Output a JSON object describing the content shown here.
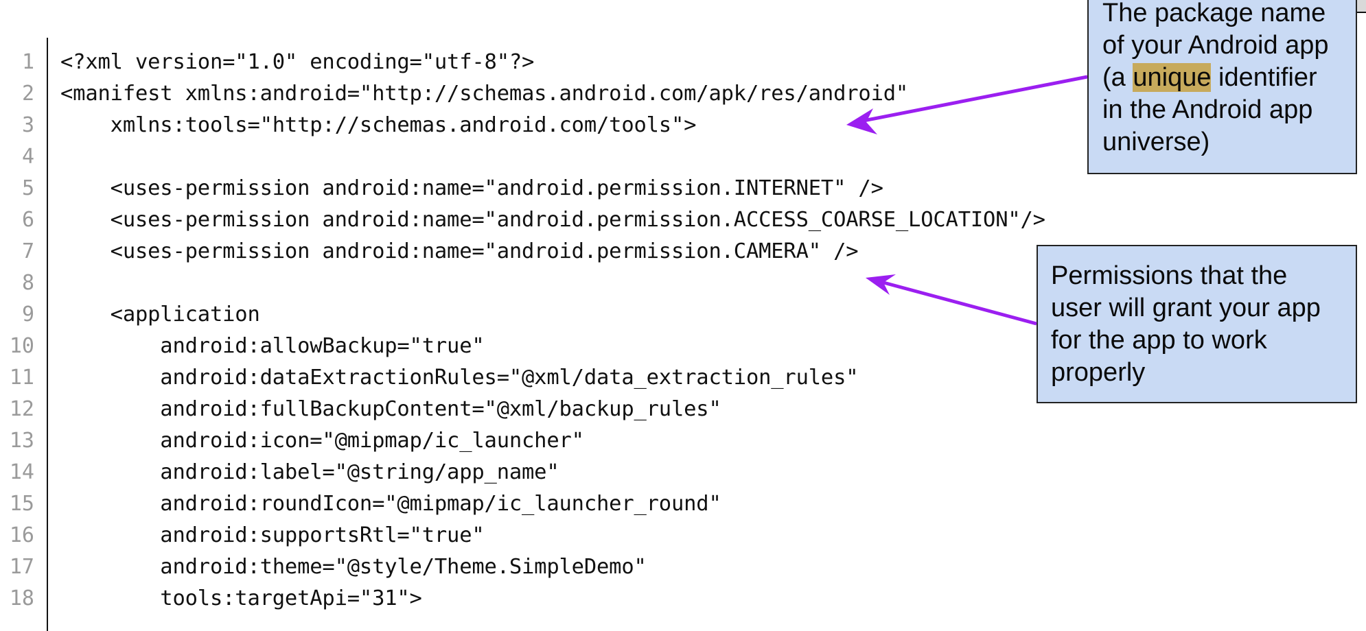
{
  "code": {
    "lines": [
      {
        "n": "1",
        "text": "<?xml version=\"1.0\" encoding=\"utf-8\"?>"
      },
      {
        "n": "2",
        "text": "<manifest xmlns:android=\"http://schemas.android.com/apk/res/android\""
      },
      {
        "n": "3",
        "text": "    xmlns:tools=\"http://schemas.android.com/tools\">"
      },
      {
        "n": "4",
        "text": ""
      },
      {
        "n": "5",
        "text": "    <uses-permission android:name=\"android.permission.INTERNET\" />"
      },
      {
        "n": "6",
        "text": "    <uses-permission android:name=\"android.permission.ACCESS_COARSE_LOCATION\"/>"
      },
      {
        "n": "7",
        "text": "    <uses-permission android:name=\"android.permission.CAMERA\" />"
      },
      {
        "n": "8",
        "text": ""
      },
      {
        "n": "9",
        "text": "    <application"
      },
      {
        "n": "10",
        "text": "        android:allowBackup=\"true\""
      },
      {
        "n": "11",
        "text": "        android:dataExtractionRules=\"@xml/data_extraction_rules\""
      },
      {
        "n": "12",
        "text": "        android:fullBackupContent=\"@xml/backup_rules\""
      },
      {
        "n": "13",
        "text": "        android:icon=\"@mipmap/ic_launcher\""
      },
      {
        "n": "14",
        "text": "        android:label=\"@string/app_name\""
      },
      {
        "n": "15",
        "text": "        android:roundIcon=\"@mipmap/ic_launcher_round\""
      },
      {
        "n": "16",
        "text": "        android:supportsRtl=\"true\""
      },
      {
        "n": "17",
        "text": "        android:theme=\"@style/Theme.SimpleDemo\""
      },
      {
        "n": "18",
        "text": "        tools:targetApi=\"31\">"
      }
    ]
  },
  "callouts": {
    "package_name": {
      "lines": [
        "The package name",
        "of your Android app",
        "(a ",
        "unique",
        " identifier",
        "in the Android app",
        "universe)"
      ]
    },
    "permissions": {
      "lines": [
        "Permissions that the",
        "user will grant your app",
        "for the app to work",
        "properly"
      ]
    }
  },
  "colors": {
    "callout_fill": "#c9daf4",
    "arrow": "#9b1ff0",
    "highlight": "#c7aa5c",
    "line_number": "#9a9a9a"
  }
}
